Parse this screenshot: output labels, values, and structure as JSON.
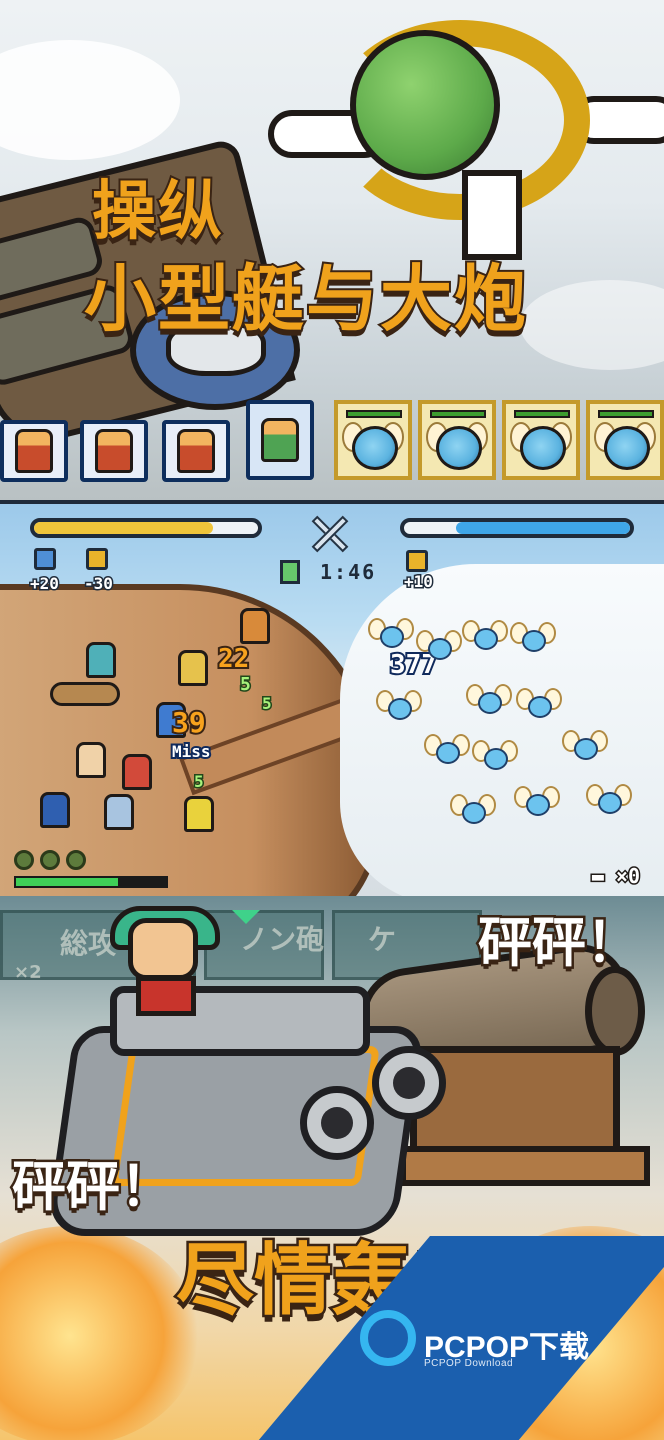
{
  "top_panel": {
    "title_line1": "操纵",
    "title_line2": "小型艇与大炮"
  },
  "battle": {
    "timer": "1:46",
    "left_stats": [
      {
        "icon": "shield-icon",
        "value": "+20"
      },
      {
        "icon": "lock-icon",
        "value": "-30"
      }
    ],
    "right_stat": {
      "icon": "lock-icon",
      "value": "+10"
    },
    "damage_popups": [
      "377",
      "22",
      "39",
      "Miss",
      "5",
      "5",
      "5"
    ],
    "cannon_count": "×0",
    "player_hp_fraction": 0.8,
    "enemy_hp_fraction": 0.77,
    "exp_fraction": 0.68
  },
  "bottom_panel": {
    "menu_labels": [
      "総攻",
      "ノン砲",
      "ケ"
    ],
    "menu_count": "×2",
    "sfx_1": "砰砰！",
    "sfx_2": "砰砰！",
    "tagline": "尽情轰击！"
  },
  "watermark": {
    "brand": "PCPOP下载",
    "sub": "PCPOP Download"
  },
  "colors": {
    "title_orange": "#f0a21c",
    "outline_brown": "#3a2414",
    "player_hp": "#f0c53a",
    "enemy_hp": "#3fa6e8",
    "watermark_blue": "#1b5fae"
  }
}
